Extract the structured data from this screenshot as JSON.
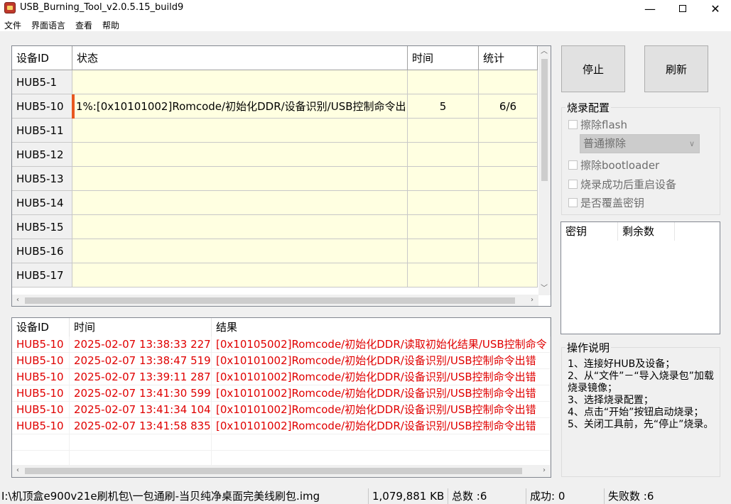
{
  "window": {
    "title": "USB_Burning_Tool_v2.0.5.15_build9",
    "icon": "usb-tool-icon",
    "controls": {
      "minimize": "—",
      "close": "✕"
    }
  },
  "menu": [
    "文件",
    "界面语言",
    "查看",
    "帮助"
  ],
  "device_grid": {
    "headers": [
      "设备ID",
      "状态",
      "时间",
      "统计"
    ],
    "rows": [
      {
        "id": "HUB5-1",
        "status": "",
        "time": "",
        "stat": ""
      },
      {
        "id": "HUB5-10",
        "status": "1%:[0x10101002]Romcode/初始化DDR/设备识别/USB控制命令出",
        "time": "5",
        "stat": "6/6",
        "progress": 1
      },
      {
        "id": "HUB5-11",
        "status": "",
        "time": "",
        "stat": ""
      },
      {
        "id": "HUB5-12",
        "status": "",
        "time": "",
        "stat": ""
      },
      {
        "id": "HUB5-13",
        "status": "",
        "time": "",
        "stat": ""
      },
      {
        "id": "HUB5-14",
        "status": "",
        "time": "",
        "stat": ""
      },
      {
        "id": "HUB5-15",
        "status": "",
        "time": "",
        "stat": ""
      },
      {
        "id": "HUB5-16",
        "status": "",
        "time": "",
        "stat": ""
      },
      {
        "id": "HUB5-17",
        "status": "",
        "time": "",
        "stat": ""
      }
    ],
    "row_highlight_color": "#ffffe1",
    "progress_color": "#e8581f"
  },
  "buttons": {
    "stop": "停止",
    "refresh": "刷新"
  },
  "burn_config": {
    "title": "烧录配置",
    "erase_flash": "擦除flash",
    "erase_mode": "普通擦除",
    "erase_bootloader": "擦除bootloader",
    "reboot_after_success": "烧录成功后重启设备",
    "overwrite_key": "是否覆盖密钥"
  },
  "key_list": {
    "headers": [
      "密钥",
      "剩余数"
    ]
  },
  "ops": {
    "title": "操作说明",
    "lines": [
      "1、连接好HUB及设备；",
      "2、从“文件”－“导入烧录包”加载烧录镜像；",
      "3、选择烧录配置；",
      "4、点击“开始”按钮启动烧录；",
      "5、关闭工具前，先“停止”烧录。"
    ]
  },
  "log": {
    "headers": [
      "设备ID",
      "时间",
      "结果"
    ],
    "rows": [
      {
        "id": "HUB5-10",
        "time": "2025-02-07 13:38:33 227",
        "result": "[0x10105002]Romcode/初始化DDR/读取初始化结果/USB控制命令"
      },
      {
        "id": "HUB5-10",
        "time": "2025-02-07 13:38:47 519",
        "result": "[0x10101002]Romcode/初始化DDR/设备识别/USB控制命令出错"
      },
      {
        "id": "HUB5-10",
        "time": "2025-02-07 13:39:11 287",
        "result": "[0x10101002]Romcode/初始化DDR/设备识别/USB控制命令出错"
      },
      {
        "id": "HUB5-10",
        "time": "2025-02-07 13:41:30 599",
        "result": "[0x10101002]Romcode/初始化DDR/设备识别/USB控制命令出错"
      },
      {
        "id": "HUB5-10",
        "time": "2025-02-07 13:41:34 104",
        "result": "[0x10101002]Romcode/初始化DDR/设备识别/USB控制命令出错"
      },
      {
        "id": "HUB5-10",
        "time": "2025-02-07 13:41:58 835",
        "result": "[0x10101002]Romcode/初始化DDR/设备识别/USB控制命令出错"
      }
    ],
    "error_color": "#e00000"
  },
  "statusbar": {
    "path": "I:\\机顶盒e900v21e刷机包\\一包通刷-当贝纯净桌面完美线刷包.img",
    "size": "1,079,881 KB",
    "total": "总数 :6",
    "success": "成功:  0",
    "failed": "失败数 :6"
  }
}
